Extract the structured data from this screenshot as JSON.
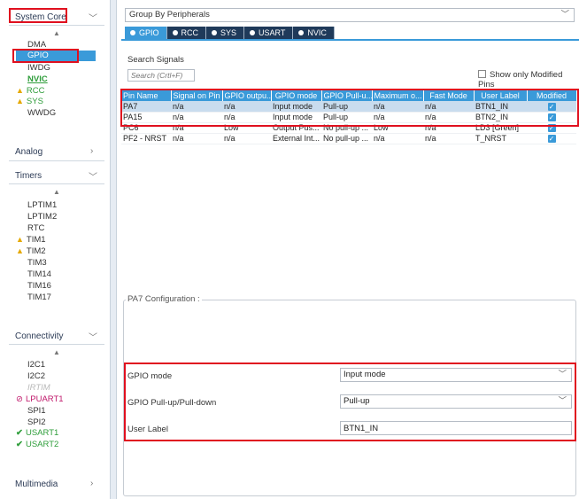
{
  "sidebar": {
    "system_core": {
      "label": "System Core",
      "items": [
        {
          "label": "DMA"
        },
        {
          "label": "GPIO"
        },
        {
          "label": "IWDG"
        },
        {
          "label": "NVIC"
        },
        {
          "label": "RCC"
        },
        {
          "label": "SYS"
        },
        {
          "label": "WWDG"
        }
      ]
    },
    "analog": {
      "label": "Analog"
    },
    "timers": {
      "label": "Timers",
      "items": [
        {
          "label": "LPTIM1"
        },
        {
          "label": "LPTIM2"
        },
        {
          "label": "RTC"
        },
        {
          "label": "TIM1"
        },
        {
          "label": "TIM2"
        },
        {
          "label": "TIM3"
        },
        {
          "label": "TIM14"
        },
        {
          "label": "TIM16"
        },
        {
          "label": "TIM17"
        }
      ]
    },
    "connectivity": {
      "label": "Connectivity",
      "items": [
        {
          "label": "I2C1"
        },
        {
          "label": "I2C2"
        },
        {
          "label": "IRTIM"
        },
        {
          "label": "LPUART1"
        },
        {
          "label": "SPI1"
        },
        {
          "label": "SPI2"
        },
        {
          "label": "USART1"
        },
        {
          "label": "USART2"
        }
      ]
    },
    "multimedia": {
      "label": "Multimedia"
    }
  },
  "main": {
    "group_by": "Group By Peripherals",
    "tabs": [
      {
        "label": "GPIO"
      },
      {
        "label": "RCC"
      },
      {
        "label": "SYS"
      },
      {
        "label": "USART"
      },
      {
        "label": "NVIC"
      }
    ],
    "search": {
      "label": "Search Signals",
      "placeholder": "Search (Crtl+F)"
    },
    "show_modified_label": "Show only Modified Pins",
    "table": {
      "headers": [
        "Pin Name",
        "Signal on Pin",
        "GPIO outpu...",
        "GPIO mode",
        "GPIO Pull-u...",
        "Maximum o...",
        "Fast Mode",
        "User Label",
        "Modified"
      ],
      "rows": [
        {
          "pin": "PA7",
          "signal": "n/a",
          "output": "n/a",
          "mode": "Input mode",
          "pull": "Pull-up",
          "max": "n/a",
          "fast": "n/a",
          "label": "BTN1_IN",
          "modified": "✓"
        },
        {
          "pin": "PA15",
          "signal": "n/a",
          "output": "n/a",
          "mode": "Input mode",
          "pull": "Pull-up",
          "max": "n/a",
          "fast": "n/a",
          "label": "BTN2_IN",
          "modified": "✓"
        },
        {
          "pin": "PC6",
          "signal": "n/a",
          "output": "Low",
          "mode": "Output Pus...",
          "pull": "No pull-up ...",
          "max": "Low",
          "fast": "n/a",
          "label": "LD3 [Green]",
          "modified": "✓"
        },
        {
          "pin": "PF2 - NRST",
          "signal": "n/a",
          "output": "n/a",
          "mode": "External Int...",
          "pull": "No pull-up ...",
          "max": "n/a",
          "fast": "n/a",
          "label": "T_NRST",
          "modified": "✓"
        }
      ]
    },
    "config": {
      "title": "PA7 Configuration :",
      "gpio_mode_label": "GPIO mode",
      "gpio_mode_value": "Input mode",
      "pull_label": "GPIO Pull-up/Pull-down",
      "pull_value": "Pull-up",
      "user_label_label": "User Label",
      "user_label_value": "BTN1_IN"
    }
  },
  "colors": {
    "accent": "#3a9ad9",
    "tab_dark": "#1f3a5a",
    "highlight": "#e0101f",
    "ok_green": "#2e9d3a",
    "warning": "#e5a800",
    "error": "#c0186b"
  }
}
